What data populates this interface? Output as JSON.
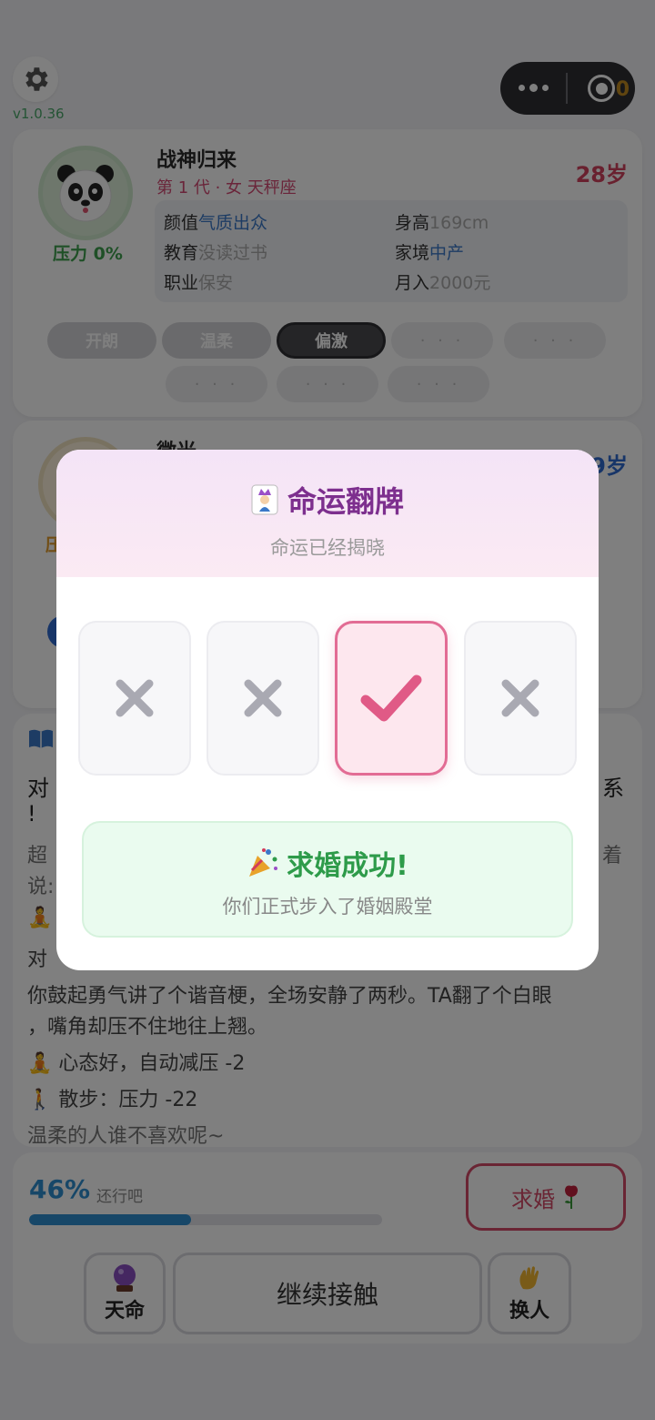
{
  "header": {
    "version": "v1.0.36",
    "coin_fragment": "0"
  },
  "self_card": {
    "name": "战神归来",
    "subtitle": "第 1 代 · 女 天秤座",
    "age": "28岁",
    "pressure": "压力 0%",
    "info": {
      "looks_label": "颜值",
      "looks_value": "气质出众",
      "height_label": "身高",
      "height_value": "169cm",
      "education_label": "教育",
      "education_value": "没读过书",
      "family_label": "家境",
      "family_value": "中产",
      "job_label": "职业",
      "job_value": "保安",
      "income_label": "月入",
      "income_value": "2000元"
    },
    "tags": [
      "开朗",
      "温柔",
      "偏激",
      "· · ·",
      "· · ·",
      "· · ·",
      "· · ·",
      "· · ·"
    ]
  },
  "partner_card": {
    "name_partial": "微光",
    "age_partial": "9岁",
    "pressure_partial": "压"
  },
  "story": {
    "lines_partial": [
      "对",
      "!",
      "超",
      "说:",
      "对"
    ],
    "right_fragments": [
      "系",
      "着"
    ],
    "lines": [
      "你鼓起勇气讲了个谐音梗，全场安静了两秒。TA翻了个白眼",
      "，嘴角却压不住地往上翘。",
      "🧘 心态好，自动减压 -2",
      "🚶 散步：压力 -22",
      "温柔的人谁不喜欢呢~"
    ]
  },
  "progress": {
    "percent_label": "46%",
    "percent_value": 0.46,
    "status": "还行吧"
  },
  "actions": {
    "propose_label": "求婚",
    "fate_label": "天命",
    "continue_label": "继续接触",
    "switch_label": "换人"
  },
  "modal": {
    "title": "命运翻牌",
    "subtitle": "命运已经揭晓",
    "cards": [
      "lose",
      "lose",
      "win",
      "lose"
    ],
    "result_title": "求婚成功!",
    "result_desc": "你们正式步入了婚姻殿堂"
  },
  "colors": {
    "accent_pink": "#e26c94",
    "success_green": "#2e9b4a",
    "title_purple": "#7d2f8e",
    "progress_blue": "#2f8fd0"
  },
  "icons": [
    "gear-icon",
    "more-dots-icon",
    "record-target-icon",
    "panda-avatar-icon",
    "book-icon",
    "joker-card-icon",
    "x-mark-icon",
    "check-mark-icon",
    "party-popper-icon",
    "rose-icon",
    "crystal-ball-icon",
    "waving-hand-icon"
  ]
}
